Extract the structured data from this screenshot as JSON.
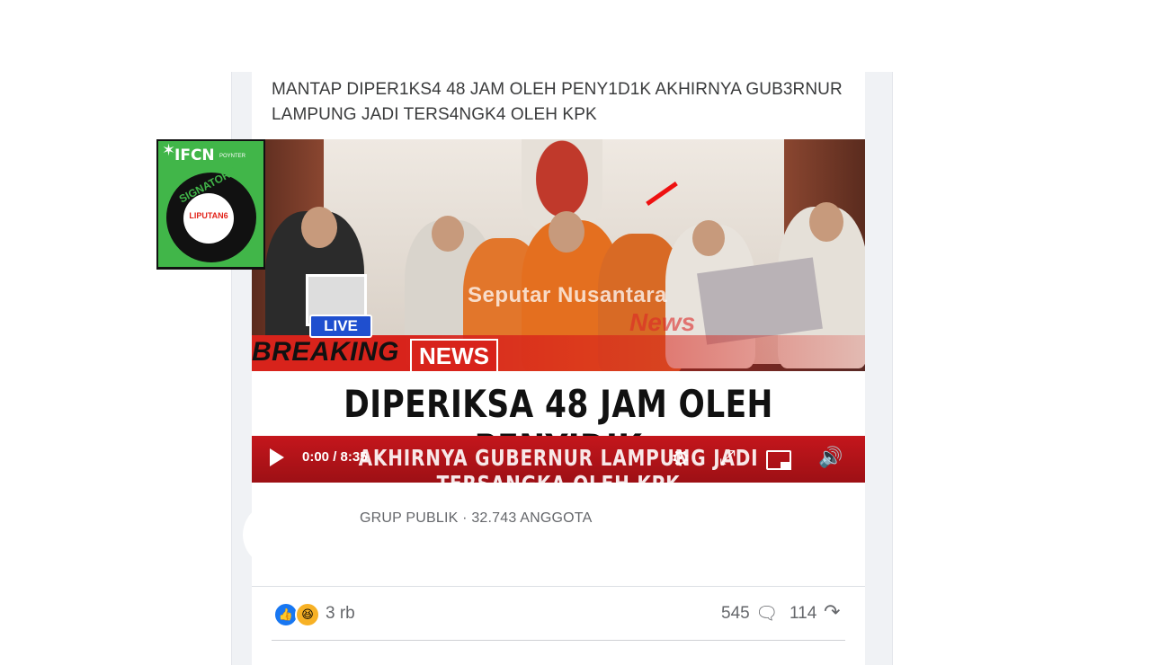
{
  "post": {
    "title": "MANTAP DIPER1KS4 48 JAM OLEH PENY1D1K AKHIRNYA GUB3RNUR LAMPUNG JADI TERS4NGK4 OLEH KPK"
  },
  "video": {
    "watermark": "Seputar Nusantara",
    "watermark_news": "News",
    "live_label": "LIVE",
    "breaking_label": "BREAKING",
    "news_label": "NEWS",
    "headline": "DIPERIKSA 48 JAM OLEH PENYIDIK",
    "subline": "AKHIRNYA GUBERNUR LAMPUNG JADI TERSANGKA OLEH KPK",
    "time": "0:00 / 8:35",
    "icons": [
      "play-icon",
      "gear-icon",
      "expand-icon",
      "pip-icon",
      "volume-icon"
    ]
  },
  "group": {
    "meta": "GRUP PUBLIK · 32.743 ANGGOTA"
  },
  "reactions": {
    "count": "3 rb",
    "comments": "545",
    "shares": "114",
    "colors": {
      "like": "#1877f2",
      "haha": "#f7b125"
    }
  },
  "badge": {
    "title": "IFCN",
    "sub": "POYNTER",
    "ring_text": "SIGNATORY",
    "logo": "LIPUTAN6"
  }
}
